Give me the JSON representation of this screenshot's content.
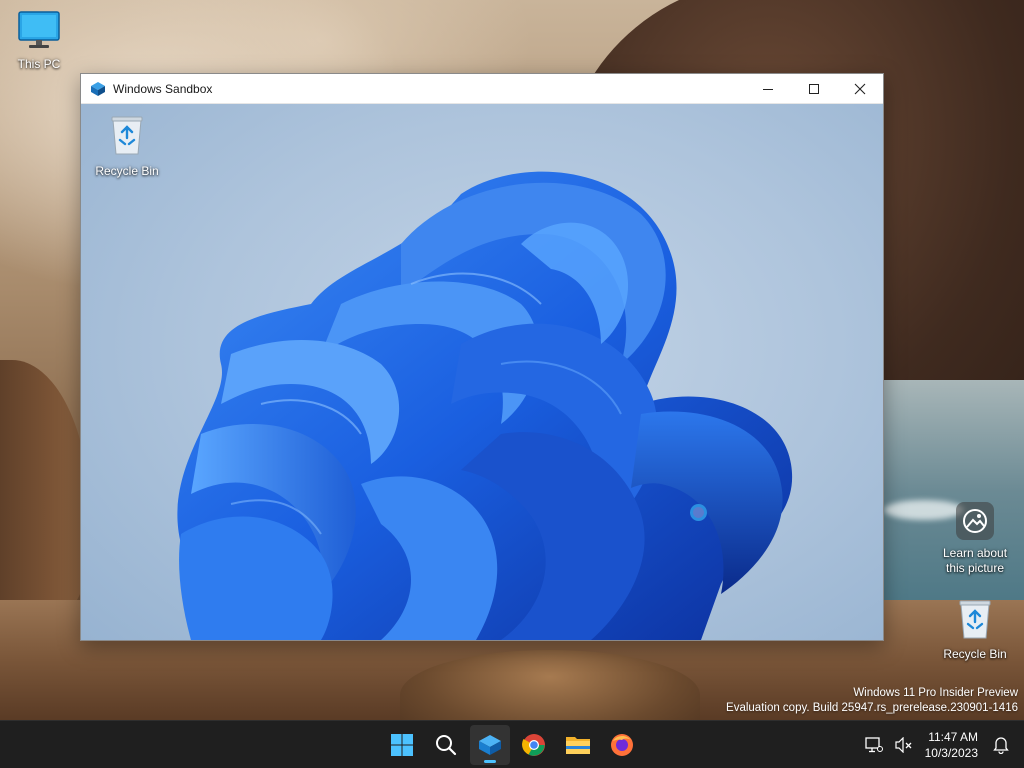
{
  "desktop": {
    "icons": {
      "this_pc": "This PC",
      "recycle_bin": "Recycle Bin",
      "learn_line1": "Learn about",
      "learn_line2": "this picture"
    },
    "watermark": {
      "line1": "Windows 11 Pro Insider Preview",
      "line2": "Evaluation copy. Build 25947.rs_prerelease.230901-1416"
    }
  },
  "sandbox_window": {
    "title": "Windows Sandbox",
    "controls": [
      "minimize",
      "maximize",
      "close"
    ],
    "guest_desktop": {
      "recycle_bin": "Recycle Bin"
    }
  },
  "taskbar": {
    "apps": [
      {
        "name": "start",
        "icon": "windows-logo-icon"
      },
      {
        "name": "search",
        "icon": "search-icon"
      },
      {
        "name": "windows-sandbox",
        "icon": "sandbox-icon",
        "active": true
      },
      {
        "name": "chrome",
        "icon": "chrome-icon"
      },
      {
        "name": "file-explorer",
        "icon": "folder-icon"
      },
      {
        "name": "firefox",
        "icon": "firefox-icon"
      }
    ],
    "clock": {
      "time": "11:47 AM",
      "date": "10/3/2023"
    }
  },
  "colors": {
    "taskbar": "#1f1f1f",
    "accent": "#4cc2ff",
    "bloom": "#1a5fe0"
  }
}
